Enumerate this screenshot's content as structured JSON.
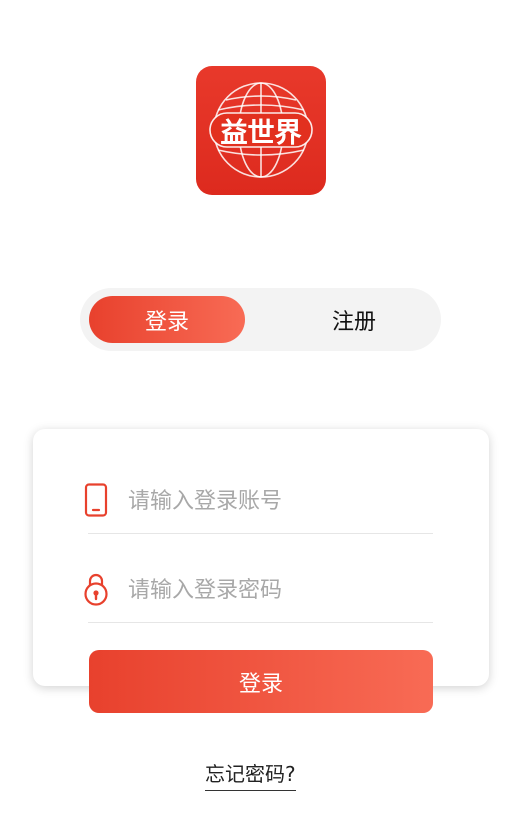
{
  "logo": {
    "text": "益世界",
    "background_color": "#e2301f",
    "icon": "globe-icon"
  },
  "tabs": {
    "login_label": "登录",
    "register_label": "注册",
    "active": "login"
  },
  "form": {
    "account": {
      "placeholder": "请输入登录账号",
      "value": "",
      "icon": "phone-icon"
    },
    "password": {
      "placeholder": "请输入登录密码",
      "value": "",
      "icon": "lock-icon"
    }
  },
  "login_button": {
    "label": "登录"
  },
  "forgot_link": {
    "label": "忘记密码?"
  },
  "colors": {
    "accent_start": "#e8412d",
    "accent_end": "#f86b55",
    "tab_track": "#f3f3f3"
  }
}
